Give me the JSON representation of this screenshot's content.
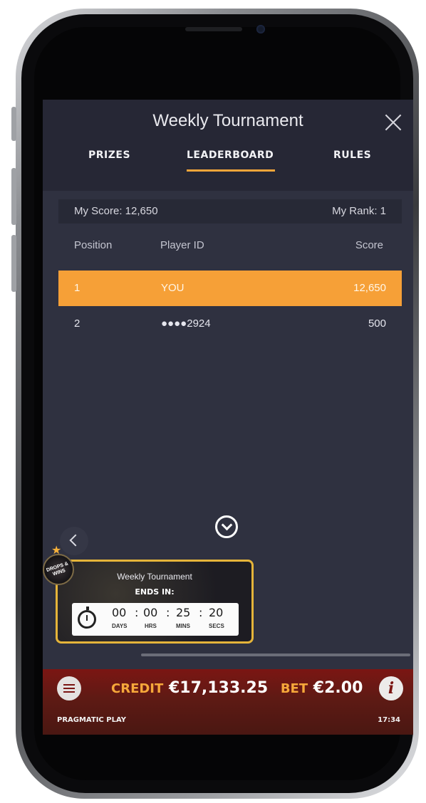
{
  "header": {
    "title": "Weekly Tournament"
  },
  "tabs": [
    {
      "label": "PRIZES"
    },
    {
      "label": "LEADERBOARD"
    },
    {
      "label": "RULES"
    }
  ],
  "summary": {
    "my_score": "My Score: 12,650",
    "my_rank": "My Rank: 1"
  },
  "table": {
    "columns": [
      "Position",
      "Player ID",
      "Score"
    ],
    "rows": [
      {
        "position": "1",
        "player_id": "YOU",
        "score": "12,650"
      },
      {
        "position": "2",
        "player_id": "●●●●2924",
        "score": "500"
      }
    ]
  },
  "widget": {
    "badge_text": "DROPS & WINS",
    "title": "Weekly Tournament",
    "ends_label": "ENDS IN:",
    "timer": {
      "days": "00",
      "hrs": "00",
      "mins": "25",
      "secs": "20",
      "days_label": "DAYS",
      "hrs_label": "HRS",
      "mins_label": "MINS",
      "secs_label": "SECS"
    }
  },
  "bottom_bar": {
    "credit_label": "CREDIT",
    "credit_value": "€17,133.25",
    "bet_label": "BET",
    "bet_value": "€2.00",
    "brand": "PRAGMATIC PLAY",
    "clock": "17:34"
  },
  "colors": {
    "accent": "#f6a037",
    "panel": "#2f3140",
    "bottom_bar": "#6b1814"
  },
  "icons": [
    "close-icon",
    "chevron-down-icon",
    "chevron-left-icon",
    "stopwatch-icon",
    "menu-icon",
    "info-icon",
    "star-icon"
  ]
}
